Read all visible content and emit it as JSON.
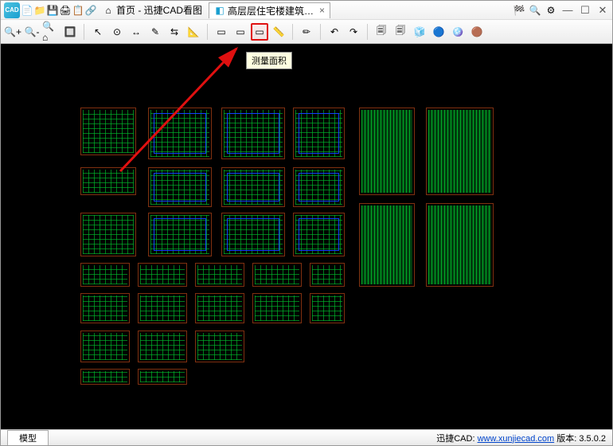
{
  "app_icon_text": "CAD",
  "titlebar": {
    "icons": [
      "📄",
      "📁",
      "💾",
      "🖨",
      "📋",
      "🔗"
    ],
    "home_tab": "首页 - 迅捷CAD看图",
    "file_tab": "高层层住宅楼建筑…",
    "file_close": "×",
    "right_icons": [
      "🏁",
      "🔍",
      "⚙"
    ],
    "min": "—",
    "max": "☐",
    "close": "✕"
  },
  "toolbar": {
    "grp1": [
      "🔍+",
      "🔍-",
      "🔍⌂",
      "🔲"
    ],
    "grp2": [
      "↖",
      "⊙",
      "↔",
      "✎",
      "⇆",
      "📐"
    ],
    "grp3": [
      "▭",
      "▭"
    ],
    "hl": "▭",
    "grp4": [
      "📏",
      "✏"
    ],
    "grp5": [
      "↶",
      "↷"
    ],
    "grp6": [
      "🗐",
      "🗐",
      "🧊",
      "🔵",
      "🪩",
      "🟤"
    ]
  },
  "tooltip": "测量面积",
  "status": {
    "model_tab": "模型",
    "brand": "迅捷CAD:",
    "url": "www.xunjiecad.com",
    "ver_label": "版本:",
    "ver": "3.5.0.2"
  }
}
